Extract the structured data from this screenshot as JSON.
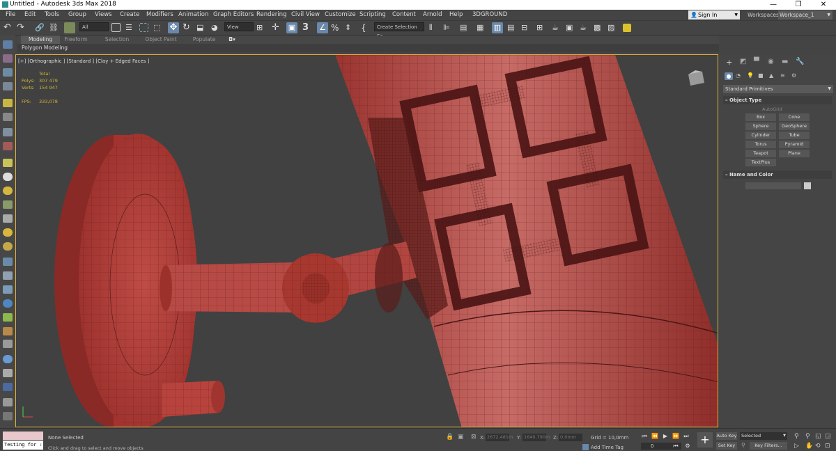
{
  "titlebar": {
    "title": "Untitled - Autodesk 3ds Max 2018",
    "minimize": "—",
    "maximize": "❐",
    "close": "✕"
  },
  "menu": [
    "File",
    "Edit",
    "Tools",
    "Group",
    "Views",
    "Create",
    "Modifiers",
    "Animation",
    "Graph Editors",
    "Rendering",
    "Civil View",
    "Customize",
    "Scripting",
    "Content",
    "Arnold",
    "Help",
    "3DGROUND"
  ],
  "account": {
    "sign_in": "Sign In",
    "workspaces_label": "Workspaces:",
    "workspace": "Workspace_1"
  },
  "toolbar": {
    "filter": "All",
    "view": "View",
    "selection_set": "Create Selection Se"
  },
  "ribbon": {
    "tabs": [
      "Modeling",
      "Freeform",
      "Selection",
      "Object Paint",
      "Populate"
    ],
    "active": "Modeling",
    "panel": "Polygon Modeling"
  },
  "viewport": {
    "label": "[+] [Orthographic ] [Standard ] [Clay + Edged Faces ]",
    "stats": {
      "total_label": "Total",
      "polys_label": "Polys:",
      "polys": "307 479",
      "verts_label": "Verts:",
      "verts": "154 947",
      "fps_label": "FPS:",
      "fps": "333,078"
    }
  },
  "command_panel": {
    "category": "Standard Primitives",
    "object_type_title": "Object Type",
    "autogrid": "AutoGrid",
    "buttons": [
      "Box",
      "Cone",
      "Sphere",
      "GeoSphere",
      "Cylinder",
      "Tube",
      "Torus",
      "Pyramid",
      "Teapot",
      "Plane",
      "TextPlus"
    ],
    "name_color_title": "Name and Color"
  },
  "status": {
    "selection": "None Selected",
    "prompt": "Click and drag to select and move objects",
    "maxscript": "Testing for :",
    "x_label": "X:",
    "x": "2672,481m",
    "y_label": "Y:",
    "y": "1640,790m",
    "z_label": "Z:",
    "z": "0,0mm",
    "grid": "Grid = 10,0mm",
    "add_time_tag": "Add Time Tag",
    "frame": "0",
    "auto_key": "Auto Key",
    "set_key": "Set Key",
    "key_mode": "Selected",
    "key_filters": "Key Filters..."
  },
  "colors": {
    "accent": "#6a88aa",
    "viewport_border": "#e2b23a",
    "model": "#b9413a",
    "stats": "#d2b437"
  }
}
